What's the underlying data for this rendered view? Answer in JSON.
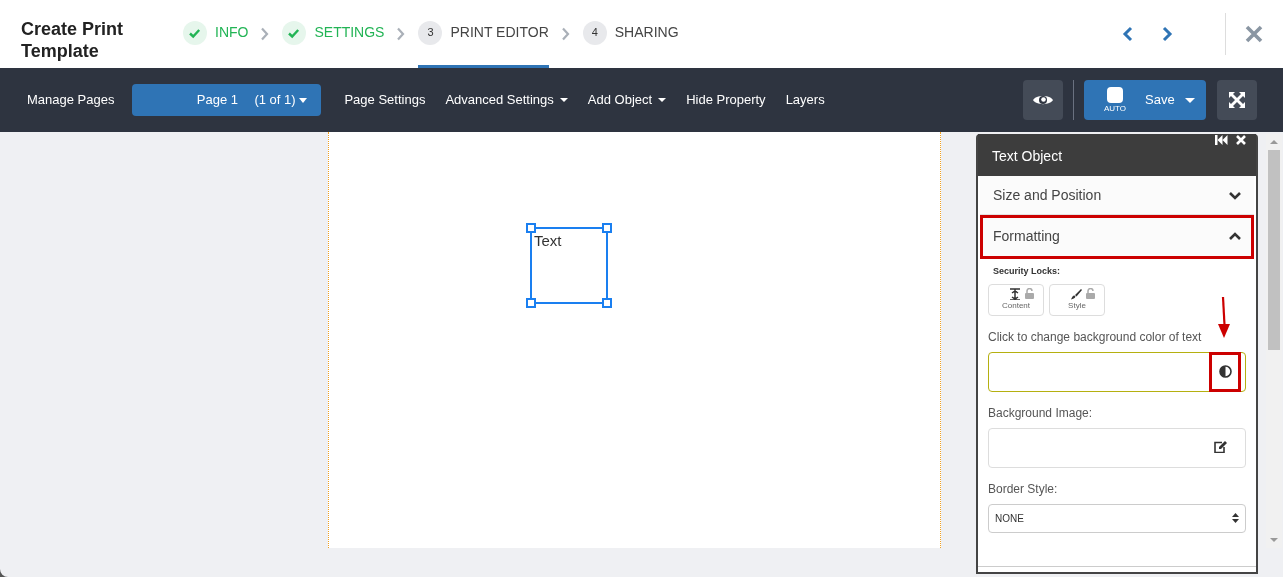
{
  "window": {
    "title": "Create Print Template"
  },
  "steps": [
    {
      "label": "INFO",
      "kind": "done",
      "selected": false
    },
    {
      "label": "SETTINGS",
      "kind": "done",
      "selected": false
    },
    {
      "number": "3",
      "label": "PRINT EDITOR",
      "kind": "current",
      "selected": true
    },
    {
      "number": "4",
      "label": "SHARING",
      "kind": "upcoming",
      "selected": false
    }
  ],
  "toolbar": {
    "manage_pages": "Manage Pages",
    "page_select": {
      "value": "Page 1",
      "count": "(1 of 1)"
    },
    "menu": [
      {
        "label": "Page Settings",
        "dropdown": false
      },
      {
        "label": "Advanced Settings",
        "dropdown": true
      },
      {
        "label": "Add Object",
        "dropdown": true
      },
      {
        "label": "Hide Property",
        "dropdown": false
      },
      {
        "label": "Layers",
        "dropdown": false
      }
    ],
    "save": {
      "label": "Save",
      "auto_label": "AUTO",
      "auto_checked": false
    }
  },
  "canvas": {
    "text_object": {
      "text": "Text",
      "selected": true
    }
  },
  "panel": {
    "title": "Text Object",
    "sections": [
      {
        "label": "Size and Position",
        "expanded": false,
        "highlighted": false
      },
      {
        "label": "Formatting",
        "expanded": true,
        "highlighted": true
      }
    ],
    "security_locks": {
      "label": "Security Locks:",
      "locks": [
        {
          "kind": "content",
          "label": "Content",
          "locked": false
        },
        {
          "kind": "style",
          "label": "Style",
          "locked": false
        }
      ]
    },
    "background_color": {
      "label": "Click to change background color of text",
      "highlighted": true
    },
    "background_image": {
      "label": "Background Image:"
    },
    "border_style": {
      "label": "Border Style:",
      "value": "NONE"
    }
  }
}
